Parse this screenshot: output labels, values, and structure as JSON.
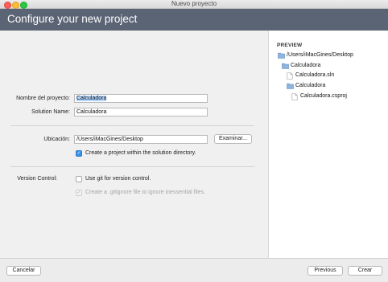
{
  "window": {
    "title": "Nuevo proyecto"
  },
  "header": {
    "title": "Configure your new project"
  },
  "form": {
    "project_name_label": "Nombre del proyecto:",
    "project_name_value": "Calculadora",
    "solution_name_label": "Solution Name:",
    "solution_name_value": "Calculadora",
    "location_label": "Ubicación:",
    "location_value": "/Users/iMacGines/Desktop",
    "browse_label": "Examinar...",
    "create_within_label": "Create a project within the solution directory.",
    "create_within_checked": true,
    "version_control_label": "Version Control:",
    "use_git_label": "Use git for version control.",
    "use_git_checked": false,
    "gitignore_label": "Create a .gitignore file to ignore inessential files.",
    "gitignore_checked": true,
    "gitignore_enabled": false
  },
  "preview": {
    "title": "PREVIEW",
    "tree": [
      {
        "label": "/Users/iMacGines/Desktop",
        "type": "folder",
        "depth": 0
      },
      {
        "label": "Calculadora",
        "type": "folder",
        "depth": 1
      },
      {
        "label": "Calculadora.sln",
        "type": "file",
        "depth": 2
      },
      {
        "label": "Calculadora",
        "type": "folder",
        "depth": 2
      },
      {
        "label": "Calculadora.csproj",
        "type": "file",
        "depth": 3
      }
    ]
  },
  "footer": {
    "cancel_label": "Cancelar",
    "previous_label": "Previous",
    "create_label": "Crear"
  },
  "colors": {
    "header_bg": "#5b6474",
    "accent": "#3a8ee6",
    "folder": "#8fb5dc"
  },
  "icons": {
    "folder": "folder-icon",
    "file": "file-icon",
    "checkmark": "checkmark-icon"
  }
}
